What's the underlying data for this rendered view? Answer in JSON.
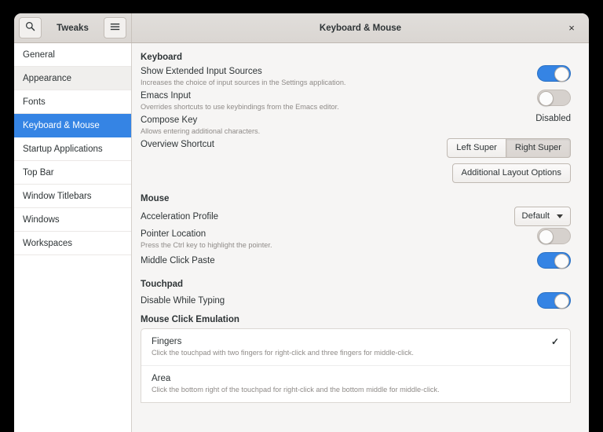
{
  "window": {
    "app_title": "Tweaks",
    "page_title": "Keyboard & Mouse",
    "close_label": "×",
    "search_icon": "search-icon",
    "menu_icon": "hamburger-menu-icon",
    "accent_color": "#3584e4",
    "header_bg": "#ddd9d5",
    "content_bg": "#f6f5f4"
  },
  "sidebar": {
    "items": [
      {
        "label": "General",
        "state": "normal"
      },
      {
        "label": "Appearance",
        "state": "hover"
      },
      {
        "label": "Fonts",
        "state": "normal"
      },
      {
        "label": "Keyboard & Mouse",
        "state": "selected"
      },
      {
        "label": "Startup Applications",
        "state": "normal"
      },
      {
        "label": "Top Bar",
        "state": "normal"
      },
      {
        "label": "Window Titlebars",
        "state": "normal"
      },
      {
        "label": "Windows",
        "state": "normal"
      },
      {
        "label": "Workspaces",
        "state": "normal"
      }
    ]
  },
  "keyboard": {
    "section_title": "Keyboard",
    "show_extended_input_sources": {
      "label": "Show Extended Input Sources",
      "description": "Increases the choice of input sources in the Settings application.",
      "toggle": "on"
    },
    "emacs_input": {
      "label": "Emacs Input",
      "description": "Overrides shortcuts to use keybindings from the Emacs editor.",
      "toggle": "off"
    },
    "compose_key": {
      "label": "Compose Key",
      "description": "Allows entering additional characters.",
      "value": "Disabled"
    },
    "overview_shortcut": {
      "label": "Overview Shortcut",
      "options": [
        {
          "label": "Left Super",
          "active": false
        },
        {
          "label": "Right Super",
          "active": true
        }
      ]
    },
    "additional_layout_options": "Additional Layout Options"
  },
  "mouse": {
    "section_title": "Mouse",
    "acceleration_profile": {
      "label": "Acceleration Profile",
      "value": "Default"
    },
    "pointer_location": {
      "label": "Pointer Location",
      "description": "Press the Ctrl key to highlight the pointer.",
      "toggle": "off"
    },
    "middle_click_paste": {
      "label": "Middle Click Paste",
      "toggle": "on"
    }
  },
  "touchpad": {
    "section_title": "Touchpad",
    "disable_while_typing": {
      "label": "Disable While Typing",
      "toggle": "on"
    },
    "mouse_click_emulation": {
      "label": "Mouse Click Emulation",
      "choices": [
        {
          "title": "Fingers",
          "description": "Click the touchpad with two fingers for right-click and three fingers for middle-click.",
          "selected": true
        },
        {
          "title": "Area",
          "description": "Click the bottom right of the touchpad for right-click and the bottom middle for middle-click.",
          "selected": false
        }
      ]
    }
  }
}
